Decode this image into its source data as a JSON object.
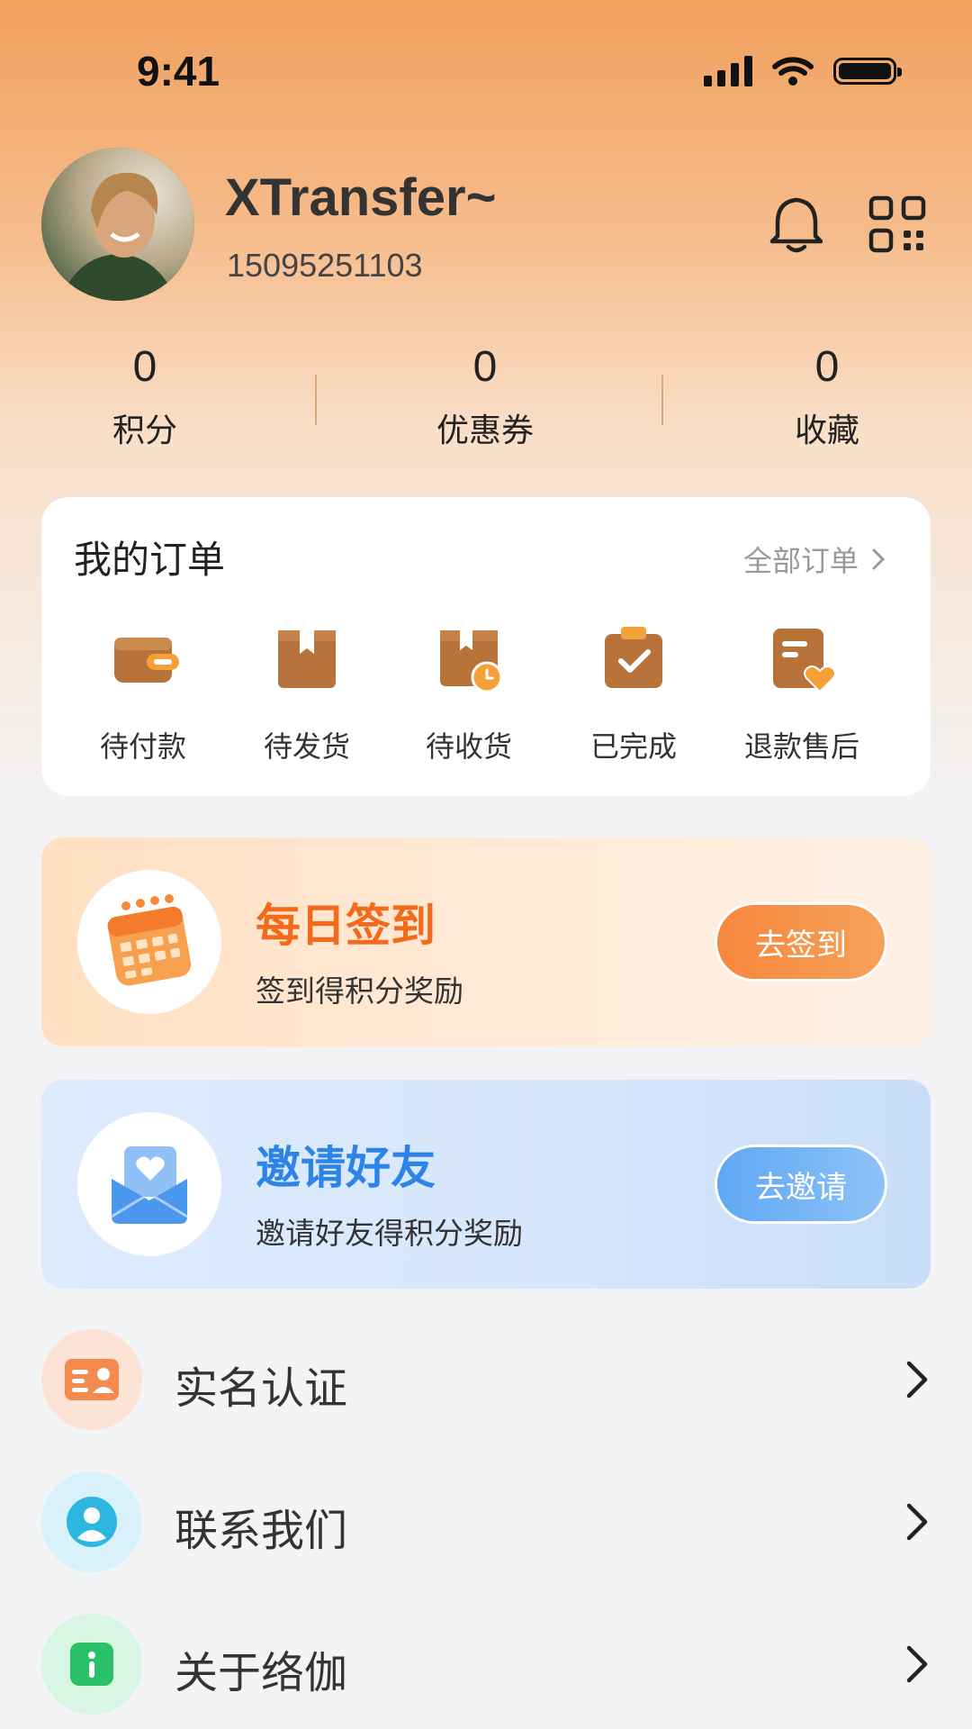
{
  "status_bar": {
    "time": "9:41"
  },
  "profile": {
    "name": "XTransfer~",
    "phone": "15095251103"
  },
  "stats": [
    {
      "value": "0",
      "label": "积分"
    },
    {
      "value": "0",
      "label": "优惠券"
    },
    {
      "value": "0",
      "label": "收藏"
    }
  ],
  "orders": {
    "title": "我的订单",
    "all_label": "全部订单",
    "items": [
      {
        "label": "待付款",
        "icon": "wallet-icon"
      },
      {
        "label": "待发货",
        "icon": "package-bookmark-icon"
      },
      {
        "label": "待收货",
        "icon": "box-clock-icon"
      },
      {
        "label": "已完成",
        "icon": "clipboard-check-icon"
      },
      {
        "label": "退款售后",
        "icon": "document-heart-icon"
      }
    ]
  },
  "checkin": {
    "title": "每日签到",
    "subtitle": "签到得积分奖励",
    "button": "去签到",
    "icon": "calendar-icon"
  },
  "invite": {
    "title": "邀请好友",
    "subtitle": "邀请好友得积分奖励",
    "button": "去邀请",
    "icon": "envelope-heart-icon"
  },
  "menu": [
    {
      "label": "实名认证",
      "icon": "id-card-icon"
    },
    {
      "label": "联系我们",
      "icon": "user-contact-icon"
    },
    {
      "label": "关于络伽",
      "icon": "info-icon"
    }
  ],
  "colors": {
    "accent_orange": "#F26A1B",
    "accent_blue": "#2C84E6",
    "order_icon_brown": "#B8733A"
  }
}
